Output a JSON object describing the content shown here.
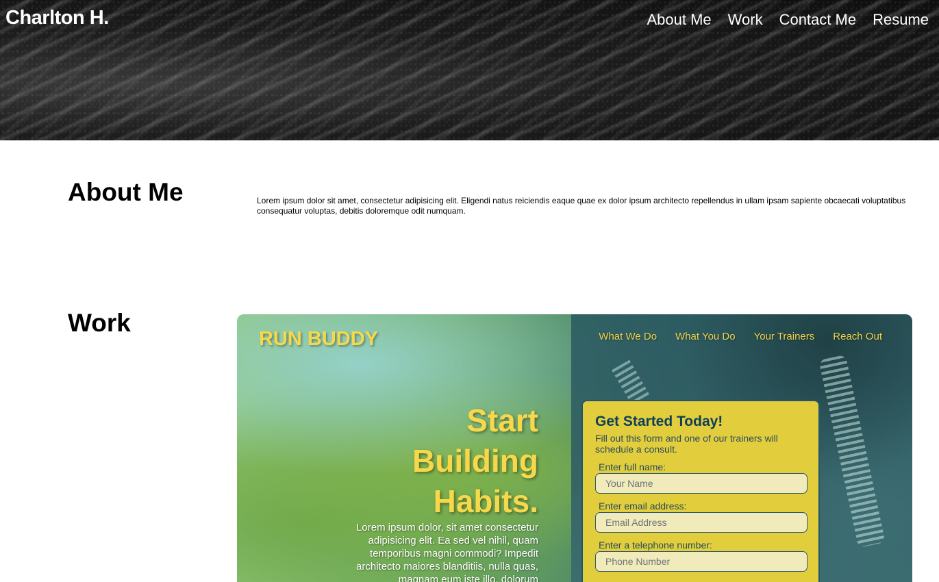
{
  "header": {
    "brand": "Charlton H.",
    "nav": [
      "About Me",
      "Work",
      "Contact Me",
      "Resume"
    ]
  },
  "about": {
    "title": "About Me",
    "text": "Lorem ipsum dolor sit amet, consectetur adipisicing elit. Eligendi natus reiciendis eaque quae ex dolor ipsum architecto repellendus in ullam ipsam sapiente obcaecati voluptatibus consequatur voluptas, debitis doloremque odit numquam."
  },
  "work": {
    "title": "Work",
    "project": {
      "logo": "RUN BUDDY",
      "nav": [
        "What We Do",
        "What You Do",
        "Your Trainers",
        "Reach Out"
      ],
      "hero_lines": [
        "Start",
        "Building",
        "Habits."
      ],
      "lede": "Lorem ipsum dolor, sit amet consectetur adipisicing elit. Ea sed vel nihil, quam temporibus magni commodi? Impedit architecto maiores blanditiis, nulla quas, magnam eum iste illo, dolorum",
      "form": {
        "title": "Get Started Today!",
        "subtitle": "Fill out this form and one of our trainers will schedule a consult.",
        "fields": [
          {
            "label": "Enter full name:",
            "placeholder": "Your Name"
          },
          {
            "label": "Enter email address:",
            "placeholder": "Email Address"
          },
          {
            "label": "Enter a telephone number:",
            "placeholder": "Phone Number"
          }
        ]
      }
    }
  }
}
